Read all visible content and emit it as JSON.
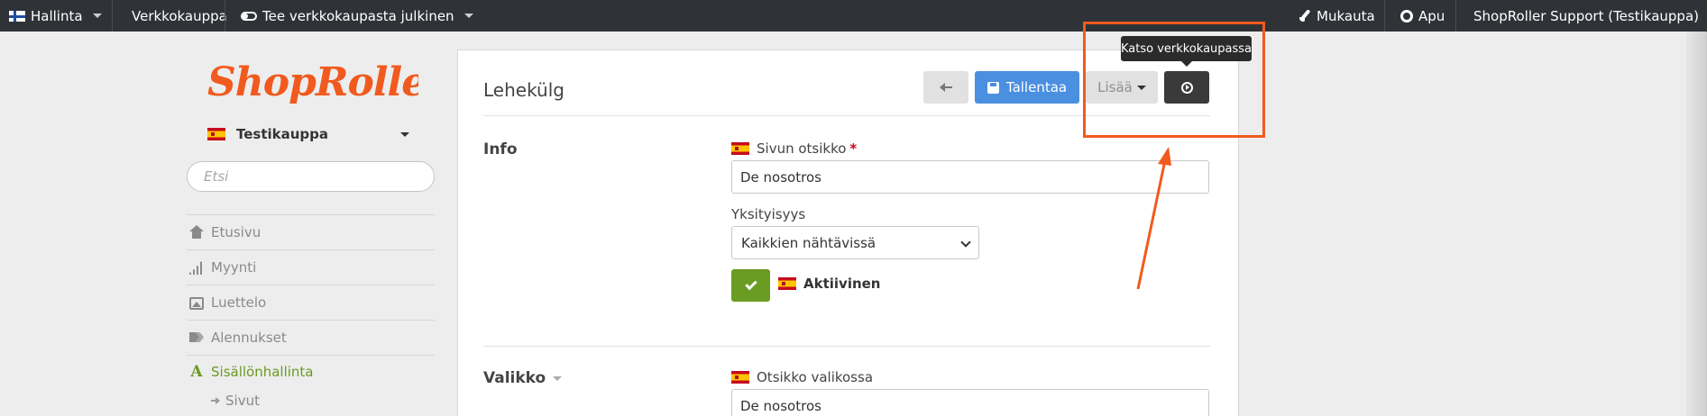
{
  "topbar": {
    "admin_label": "Hallinta",
    "store_label": "Verkkokauppa",
    "publish_label": "Tee verkkokaupasta julkinen",
    "customize_label": "Mukauta",
    "help_label": "Apu",
    "user_label": "ShopRoller Support (Testikauppa)"
  },
  "sidebar": {
    "logo_text": "ShopRoller",
    "store_name": "Testikauppa",
    "search_placeholder": "Etsi",
    "items": [
      {
        "label": "Etusivu",
        "icon": "home-icon"
      },
      {
        "label": "Myynti",
        "icon": "bar-chart-icon"
      },
      {
        "label": "Luettelo",
        "icon": "picture-icon"
      },
      {
        "label": "Alennukset",
        "icon": "tags-icon"
      },
      {
        "label": "Sisällönhallinta",
        "icon": "font-icon",
        "active": true
      }
    ],
    "sub_item": "Sivut"
  },
  "main": {
    "title": "Lehekülg",
    "save_label": "Tallentaa",
    "more_label": "Lisää",
    "tooltip": "Katso verkkokaupassa",
    "info_title": "Info",
    "page_title_label": "Sivun otsikko",
    "required_mark": "*",
    "page_title_value": "De nosotros",
    "privacy_label": "Yksityisyys",
    "privacy_value": "Kaikkien nähtävissä",
    "active_label": "Aktiivinen",
    "menu_title": "Valikko",
    "menu_title_label": "Otsikko valikossa",
    "menu_title_value": "De nosotros"
  },
  "colors": {
    "topbar": "#2f3338",
    "brand_orange": "#f15a1e",
    "save_button": "#4a8fe0",
    "active_green": "#6a9b22",
    "view_button": "#3a3a3a"
  }
}
